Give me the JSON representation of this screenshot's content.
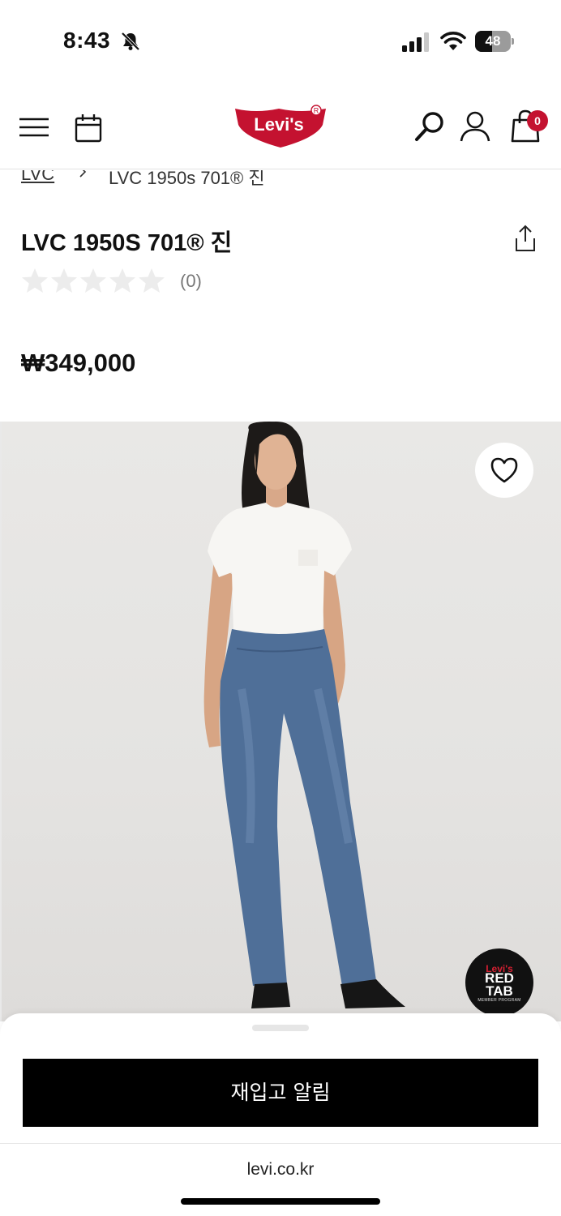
{
  "status_bar": {
    "time": "8:43",
    "battery_level": "48",
    "battery_fraction": 0.48
  },
  "header": {
    "logo_text": "Levi's",
    "cart_count": "0",
    "brand_color": "#c41230"
  },
  "breadcrumb": {
    "parent": "LVC",
    "current": "LVC 1950s 701® 진"
  },
  "product": {
    "title": "LVC 1950S 701® 진",
    "rating_stars": 0,
    "rating_max": 5,
    "review_count": "(0)",
    "price": "₩349,000"
  },
  "image": {
    "wishlist_icon": "heart-icon",
    "badge_line1": "Levi's",
    "badge_line2": "RED\nTAB",
    "badge_line3": "MEMBER PROGRAM"
  },
  "bottom_sheet": {
    "restock_label": "재입고 알림"
  },
  "browser": {
    "url": "levi.co.kr"
  }
}
